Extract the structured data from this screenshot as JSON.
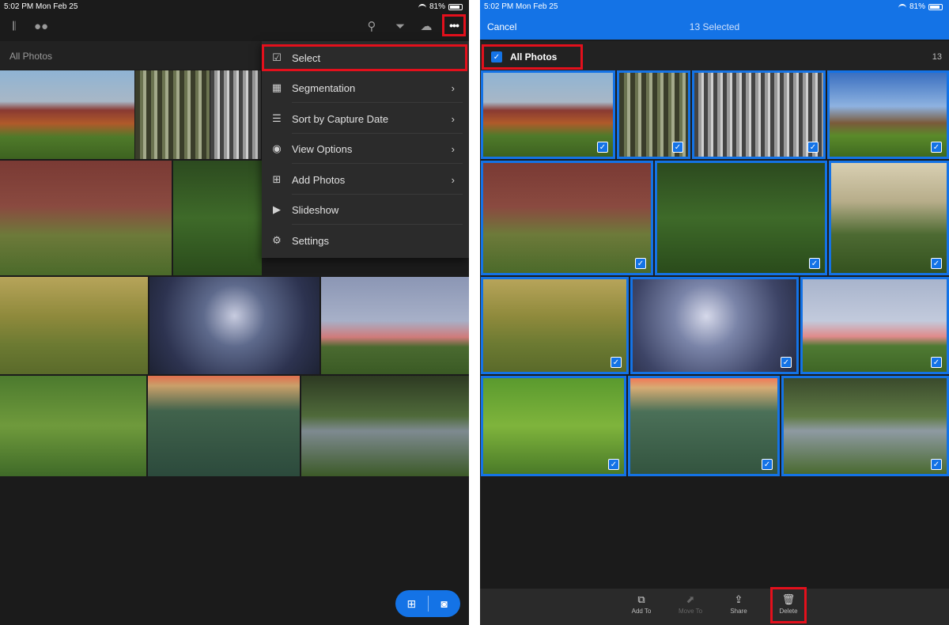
{
  "left": {
    "status": {
      "time": "5:02 PM  Mon Feb 25",
      "battery": "81%"
    },
    "toolbar": {
      "library_icon": "library-icon",
      "people_icon": "people-icon",
      "search_icon": "search-icon",
      "filter_icon": "filter-icon",
      "cloud_icon": "cloud-icon",
      "more_label": "•••"
    },
    "section_title": "All Photos",
    "menu": {
      "items": [
        {
          "label": "Select",
          "icon": "check-square-icon",
          "glyph": "☑",
          "chevron": ""
        },
        {
          "label": "Segmentation",
          "icon": "grid-icon",
          "glyph": "▦",
          "chevron": "›"
        },
        {
          "label": "Sort by Capture Date",
          "icon": "sort-icon",
          "glyph": "☰",
          "chevron": "›"
        },
        {
          "label": "View Options",
          "icon": "eye-icon",
          "glyph": "◉",
          "chevron": "›"
        },
        {
          "label": "Add Photos",
          "icon": "add-photo-icon",
          "glyph": "⊞",
          "chevron": "›"
        },
        {
          "label": "Slideshow",
          "icon": "play-icon",
          "glyph": "▶",
          "chevron": ""
        },
        {
          "label": "Settings",
          "icon": "gear-icon",
          "glyph": "⚙",
          "chevron": ""
        }
      ]
    },
    "fab": {
      "add_icon": "add-photo-icon",
      "camera_icon": "camera-icon"
    }
  },
  "right": {
    "status": {
      "time": "5:02 PM  Mon Feb 25",
      "battery": "81%"
    },
    "header": {
      "cancel_label": "Cancel",
      "selected_label": "13 Selected"
    },
    "section_title": "All Photos",
    "count": "13",
    "bottom": {
      "add_to": "Add To",
      "move_to": "Move To",
      "share": "Share",
      "delete": "Delete"
    }
  },
  "colors": {
    "accent": "#1473e6",
    "highlight": "#e3101c",
    "background": "#1b1b1b"
  }
}
